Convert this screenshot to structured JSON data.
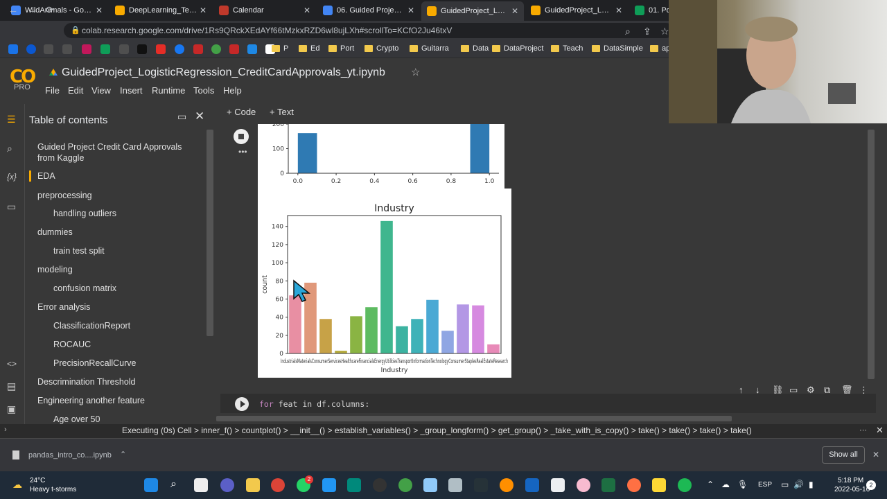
{
  "browser": {
    "tabs": [
      {
        "label": "WildAnimals - Google",
        "favicon_color": "#4285f4"
      },
      {
        "label": "DeepLearning_Tensor",
        "favicon_color": "#f9ab00"
      },
      {
        "label": "Calendar",
        "favicon_color": "#c0392b"
      },
      {
        "label": "06. Guided Project Lo",
        "favicon_color": "#4285f4"
      },
      {
        "label": "GuidedProject_Logisti",
        "favicon_color": "#f9ab00"
      },
      {
        "label": "GuidedProject_Logisti",
        "favicon_color": "#f9ab00"
      },
      {
        "label": "01. Pos",
        "favicon_color": "#0f9d58"
      }
    ],
    "active_tab": 4,
    "url": "colab.research.google.com/drive/1Rs9QRckXEdAYf66tMzkxRZD6wl8ujLXh#scrollTo=KCfO2Ju46txV",
    "bookmarks": [
      {
        "label": "P",
        "type": "folder"
      },
      {
        "label": "Ed",
        "type": "folder"
      },
      {
        "label": "Port",
        "type": "folder"
      },
      {
        "label": "Crypto",
        "type": "folder"
      },
      {
        "label": "Guitarra",
        "type": "folder"
      },
      {
        "label": "Data",
        "type": "folder"
      },
      {
        "label": "DataProject",
        "type": "folder"
      },
      {
        "label": "Teach",
        "type": "folder"
      },
      {
        "label": "DataSimple",
        "type": "folder"
      },
      {
        "label": "ap",
        "type": "folder"
      }
    ]
  },
  "colab": {
    "logo": "CO",
    "plan": "PRO",
    "notebook_title": "GuidedProject_LogisticRegression_CreditCardApprovals_yt.ipynb",
    "menu": [
      "File",
      "Edit",
      "View",
      "Insert",
      "Runtime",
      "Tools",
      "Help"
    ],
    "add_code": "+ Code",
    "add_text": "+ Text",
    "toc_title": "Table of contents",
    "toc": [
      {
        "label": "Guided Project Credit Card Approvals from Kaggle",
        "level": 1
      },
      {
        "label": "EDA",
        "level": 1,
        "active": true
      },
      {
        "label": "preprocessing",
        "level": 1
      },
      {
        "label": "handling outliers",
        "level": 2
      },
      {
        "label": "dummies",
        "level": 1
      },
      {
        "label": "train test split",
        "level": 2
      },
      {
        "label": "modeling",
        "level": 1
      },
      {
        "label": "confusion matrix",
        "level": 2
      },
      {
        "label": "Error analysis",
        "level": 1
      },
      {
        "label": "ClassificationReport",
        "level": 2
      },
      {
        "label": "ROCAUC",
        "level": 2
      },
      {
        "label": "PrecisionRecallCurve",
        "level": 2
      },
      {
        "label": "Descrimination Threshold",
        "level": 1
      },
      {
        "label": "Engineering another feature",
        "level": 1
      },
      {
        "label": "Age over 50",
        "level": 2
      }
    ],
    "code_line": {
      "keyword": "for",
      "rest": " feat in df.columns:"
    },
    "status": "Executing (0s)  Cell > inner_f() > countplot() > __init__() > establish_variables() > _group_longform() > get_group() > _take_with_is_copy() > take() > take() > take() > take()"
  },
  "downloads": {
    "file": "pandas_intro_co....ipynb",
    "show_all": "Show all"
  },
  "taskbar": {
    "temp": "24°C",
    "weather": "Heavy t-storms",
    "lang": "ESP",
    "time": "5:18 PM",
    "date": "2022-05-16",
    "notif": "2"
  },
  "chart_data": [
    {
      "type": "bar",
      "title": "",
      "x_ticks": [
        "0.0",
        "0.2",
        "0.4",
        "0.6",
        "0.8",
        "1.0"
      ],
      "y_ticks": [
        "0",
        "100",
        "200"
      ],
      "bars": [
        {
          "x": 0.05,
          "value": 163
        },
        {
          "x": 0.95,
          "value": 220
        }
      ],
      "xlim": [
        -0.05,
        1.05
      ],
      "ylim": [
        0,
        200
      ],
      "color": "#2f7ab3"
    },
    {
      "type": "bar",
      "title": "Industry",
      "xlabel": "Industry",
      "ylabel": "count",
      "ylim": [
        0,
        152
      ],
      "y_ticks": [
        0,
        20,
        40,
        60,
        80,
        100,
        120,
        140
      ],
      "tick_text": "IndustrialsMaterialsConsumerServicesHealthcareFinancialsEnergyUtilitiesTransportInformationTechnologyConsumerStaplesRealEstateResearch",
      "categories": [
        "Industrials",
        "Materials",
        "Consumer Discretionary",
        "Consumer Services",
        "Healthcare",
        "Financials",
        "Energy",
        "Utilities",
        "Transport",
        "Information Technology",
        "Consumer Staples",
        "Education",
        "Real Estate",
        "Research"
      ],
      "values": [
        64,
        78,
        38,
        3,
        41,
        51,
        146,
        30,
        38,
        59,
        25,
        54,
        53,
        10
      ],
      "colors": [
        "#e88fa3",
        "#e0987a",
        "#c7a247",
        "#b5ab3d",
        "#8ab443",
        "#5dbb61",
        "#3fb68e",
        "#3cb3a1",
        "#3fb2b8",
        "#4aa9d4",
        "#8fa6e3",
        "#b397e5",
        "#d68ae0",
        "#e88ab8"
      ]
    }
  ]
}
